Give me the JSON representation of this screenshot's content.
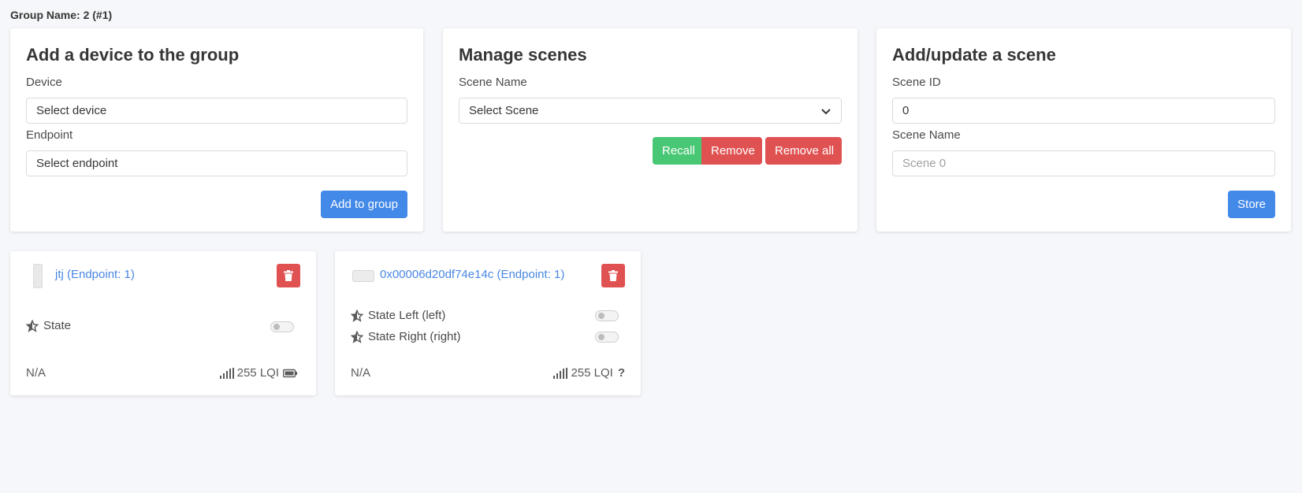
{
  "group": {
    "title": "Group Name: 2 (#1)"
  },
  "add_device": {
    "title": "Add a device to the group",
    "device_label": "Device",
    "device_value": "Select device",
    "endpoint_label": "Endpoint",
    "endpoint_value": "Select endpoint",
    "add_button": "Add to group"
  },
  "scenes": {
    "title": "Manage scenes",
    "scene_name_label": "Scene Name",
    "scene_select_value": "Select Scene",
    "recall_button": "Recall",
    "remove_button": "Remove",
    "remove_all_button": "Remove all"
  },
  "add_scene": {
    "title": "Add/update a scene",
    "scene_id_label": "Scene ID",
    "scene_id_value": "0",
    "scene_name_label": "Scene Name",
    "scene_name_placeholder": "Scene 0",
    "store_button": "Store"
  },
  "devices": [
    {
      "name": "jtj (Endpoint: 1)",
      "controls": [
        {
          "label": "State"
        }
      ],
      "last_seen": "N/A",
      "lqi": "255 LQI",
      "power_icon": "battery-icon"
    },
    {
      "name": "0x00006d20df74e14c (Endpoint: 1)",
      "controls": [
        {
          "label": "State Left (left)"
        },
        {
          "label": "State Right (right)"
        }
      ],
      "last_seen": "N/A",
      "lqi": "255 LQI",
      "power_icon": "question-icon"
    }
  ],
  "colors": {
    "primary": "#4289e8",
    "success": "#48c774",
    "danger": "#e05252",
    "link": "#4a87e2"
  }
}
